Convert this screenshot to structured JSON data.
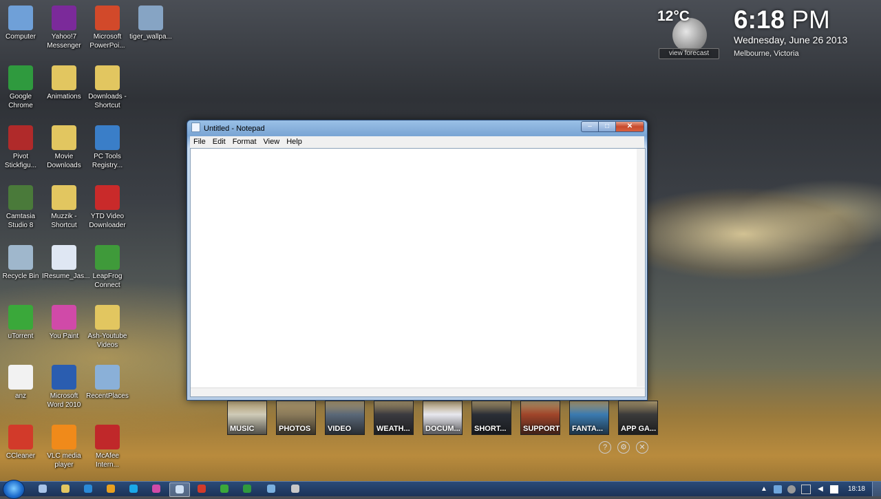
{
  "desktop_icons": [
    {
      "label": "Computer",
      "icon": "computer-icon",
      "color": "#6fa0d8"
    },
    {
      "label": "Yahoo!7 Messenger",
      "icon": "yahoo-messenger-icon",
      "color": "#7b2a9a"
    },
    {
      "label": "Microsoft PowerPoi...",
      "icon": "powerpoint-icon",
      "color": "#d2492a"
    },
    {
      "label": "tiger_wallpa...",
      "icon": "image-file-icon",
      "color": "#86a4c4"
    },
    {
      "label": "Google Chrome",
      "icon": "chrome-icon",
      "color": "#2f9a3e"
    },
    {
      "label": "Animations",
      "icon": "folder-icon",
      "color": "#e2c660"
    },
    {
      "label": "Downloads - Shortcut",
      "icon": "folder-download-icon",
      "color": "#e2c660"
    },
    {
      "label": "Pivot Stickfigu...",
      "icon": "pivot-icon",
      "color": "#b02a2a"
    },
    {
      "label": "Movie Downloads",
      "icon": "folder-icon",
      "color": "#e2c660"
    },
    {
      "label": "PC Tools Registry...",
      "icon": "gear-icon",
      "color": "#3a7ec8"
    },
    {
      "label": "Camtasia Studio 8",
      "icon": "camtasia-icon",
      "color": "#4a7a3a"
    },
    {
      "label": "Muzzik - Shortcut",
      "icon": "folder-icon",
      "color": "#e2c660"
    },
    {
      "label": "YTD Video Downloader",
      "icon": "ytd-icon",
      "color": "#c92a2a"
    },
    {
      "label": "Recycle Bin",
      "icon": "recycle-bin-icon",
      "color": "#9fb7cc"
    },
    {
      "label": "IResume_Jas...",
      "icon": "word-doc-icon",
      "color": "#dfe7f3"
    },
    {
      "label": "LeapFrog Connect",
      "icon": "leapfrog-icon",
      "color": "#3f9a3a"
    },
    {
      "label": "uTorrent",
      "icon": "utorrent-icon",
      "color": "#3aa83a"
    },
    {
      "label": "You Paint",
      "icon": "paint-icon",
      "color": "#d04aa8"
    },
    {
      "label": "Ash-Youtube Videos",
      "icon": "folder-icon",
      "color": "#e2c660"
    },
    {
      "label": "anz",
      "icon": "blank-file-icon",
      "color": "#f2f2f2"
    },
    {
      "label": "Microsoft Word 2010",
      "icon": "word-icon",
      "color": "#2a5db0"
    },
    {
      "label": "RecentPlaces",
      "icon": "recent-places-icon",
      "color": "#8ab0d8"
    },
    {
      "label": "CCleaner",
      "icon": "ccleaner-icon",
      "color": "#d23a2a"
    },
    {
      "label": "VLC media player",
      "icon": "vlc-icon",
      "color": "#f08a1a"
    },
    {
      "label": "McAfee Intern...",
      "icon": "mcafee-icon",
      "color": "#c0282a"
    }
  ],
  "weather": {
    "temp": "12°C",
    "forecast_label": "view forecast",
    "icon": "moon-icon"
  },
  "clock": {
    "time": "6:18",
    "ampm": "PM",
    "date": "Wednesday, June 26 2013",
    "location": "Melbourne, Victoria"
  },
  "notepad": {
    "title": "Untitled - Notepad",
    "menu": [
      "File",
      "Edit",
      "Format",
      "View",
      "Help"
    ],
    "content": "",
    "buttons": {
      "min": "–",
      "max": "□",
      "close": "✕"
    }
  },
  "launcher": {
    "tiles": [
      {
        "label": "MUSIC",
        "color": "#cfcbb8"
      },
      {
        "label": "PHOTOS",
        "color": "#8a7a5a"
      },
      {
        "label": "VIDEO",
        "color": "#5a6878"
      },
      {
        "label": "WEATH...",
        "color": "#3a3a40"
      },
      {
        "label": "DOCUM...",
        "color": "#e8e8ef"
      },
      {
        "label": "SHORT...",
        "color": "#2a2e36"
      },
      {
        "label": "SUPPORT",
        "color": "#a0452a"
      },
      {
        "label": "FANTA...",
        "color": "#3a7ab0"
      },
      {
        "label": "APP GA...",
        "color": "#3a3a3a"
      }
    ],
    "controls": [
      "?",
      "⚙",
      "✕"
    ]
  },
  "taskbar": {
    "pinned": [
      {
        "name": "taskbar-explorer-icon",
        "color": "#a8c4e8"
      },
      {
        "name": "taskbar-folder-icon",
        "color": "#e2c660"
      },
      {
        "name": "taskbar-ie-icon",
        "color": "#2a8ad8"
      },
      {
        "name": "taskbar-media-icon",
        "color": "#e8a020"
      },
      {
        "name": "taskbar-skype-icon",
        "color": "#1aa8e8"
      },
      {
        "name": "taskbar-paint-icon",
        "color": "#d04aa8"
      },
      {
        "name": "taskbar-notepad-icon",
        "color": "#cfe0f4"
      },
      {
        "name": "taskbar-ccleaner-icon",
        "color": "#d23a2a"
      },
      {
        "name": "taskbar-utorrent-icon",
        "color": "#3aa83a"
      },
      {
        "name": "taskbar-chrome-icon",
        "color": "#2f9a3e"
      },
      {
        "name": "taskbar-network-icon",
        "color": "#7ab0e0"
      },
      {
        "name": "taskbar-app-icon",
        "color": "#c8c8c8"
      }
    ],
    "clock": "18:18"
  }
}
